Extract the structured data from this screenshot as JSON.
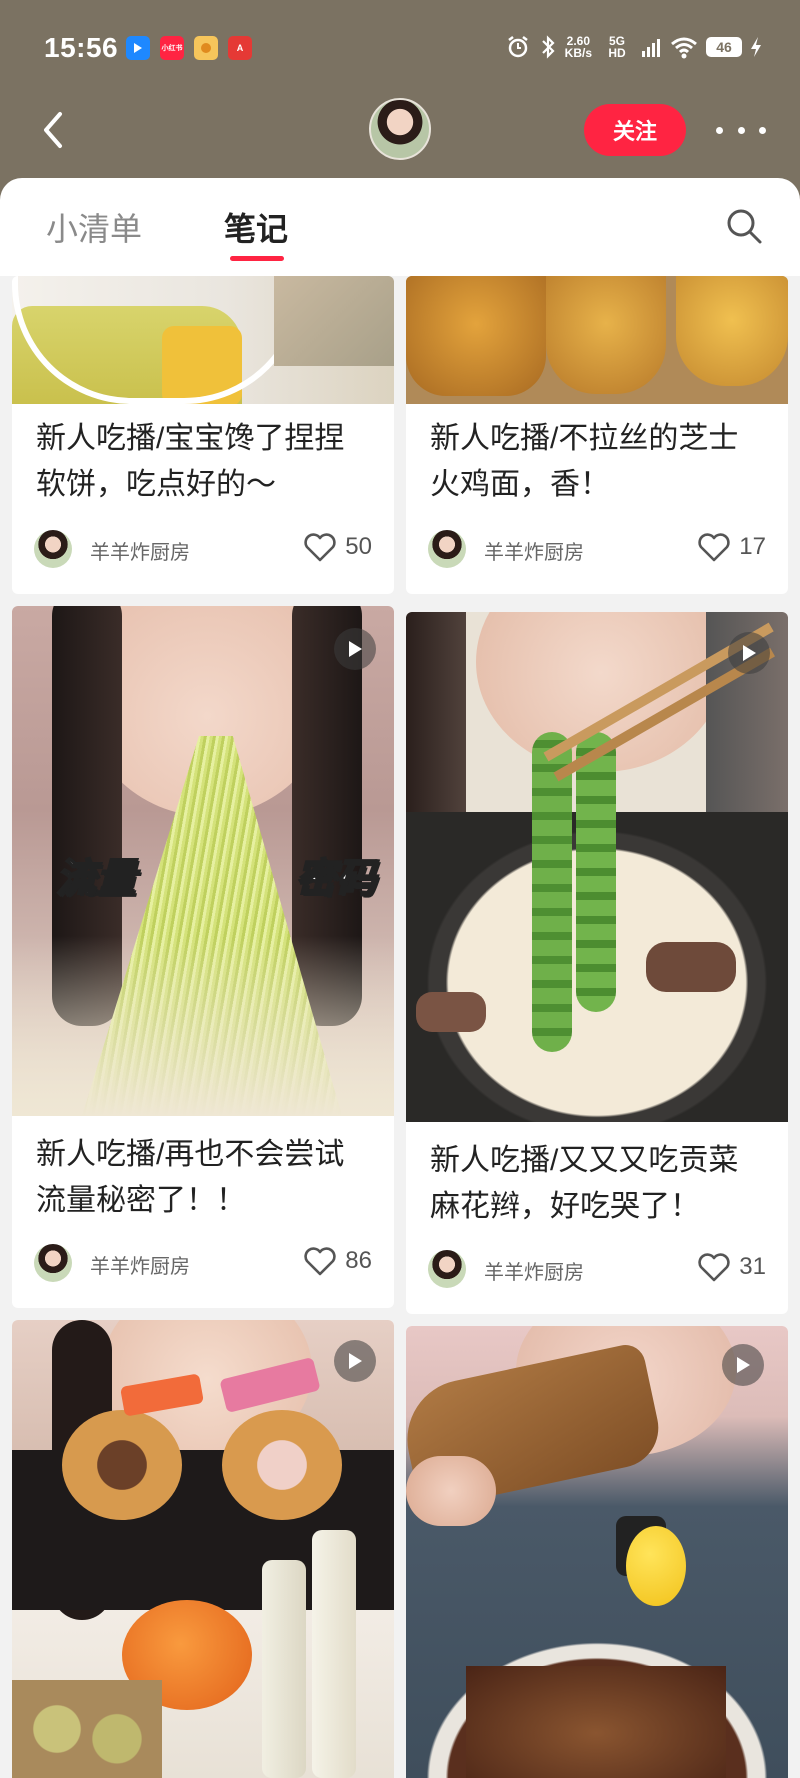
{
  "status_bar": {
    "time": "15:56",
    "net_speed": "2.60",
    "net_unit": "KB/s",
    "signal": "5G HD",
    "battery": "46",
    "app_icons": [
      {
        "name": "blue-app",
        "color": "#1e88ff",
        "text": ""
      },
      {
        "name": "red-app",
        "color": "#ff2442",
        "text": "小红书"
      },
      {
        "name": "yellow-app",
        "color": "#f6c55b",
        "text": ""
      },
      {
        "name": "red-a-app",
        "color": "#e53935",
        "text": "A"
      }
    ]
  },
  "nav": {
    "follow_label": "关注"
  },
  "tabs": {
    "list_label": "小清单",
    "notes_label": "笔记"
  },
  "notes": [
    {
      "title": "新人吃播/宝宝馋了捏捏软饼，吃点好的～",
      "author": "羊羊炸厨房",
      "likes": "50"
    },
    {
      "title": "新人吃播/不拉丝的芝士火鸡面，香！",
      "author": "羊羊炸厨房",
      "likes": "17"
    },
    {
      "title": "新人吃播/再也不会尝试流量秘密了！！",
      "author": "羊羊炸厨房",
      "likes": "86",
      "overlay_left": "流量",
      "overlay_right": "密码"
    },
    {
      "title": "新人吃播/又又又吃贡菜麻花辫，好吃哭了！",
      "author": "羊羊炸厨房",
      "likes": "31"
    }
  ],
  "colors": {
    "accent": "#ff2442",
    "header_bg": "#7b7262"
  }
}
